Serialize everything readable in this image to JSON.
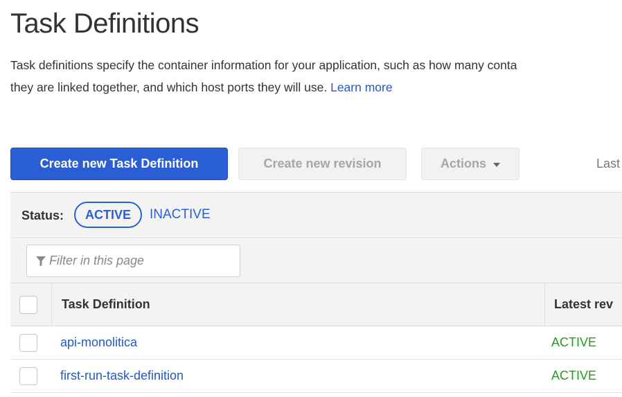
{
  "page": {
    "title": "Task Definitions",
    "description_line1": "Task definitions specify the container information for your application, such as how many conta",
    "description_line2": "they are linked together, and which host ports they will use.",
    "learn_more": "Learn more"
  },
  "toolbar": {
    "create_label": "Create new Task Definition",
    "revision_label": "Create new revision",
    "actions_label": "Actions",
    "last_label": "Last"
  },
  "status_filter": {
    "label": "Status:",
    "active": "ACTIVE",
    "inactive": "INACTIVE"
  },
  "filter": {
    "placeholder": "Filter in this page",
    "icon": "filter-icon"
  },
  "table": {
    "columns": [
      "Task Definition",
      "Latest rev"
    ],
    "rows": [
      {
        "name": "api-monolitica",
        "status": "ACTIVE"
      },
      {
        "name": "first-run-task-definition",
        "status": "ACTIVE"
      }
    ]
  },
  "colors": {
    "primary": "#2a5ed4",
    "link": "#2458c5",
    "active_status": "#1d9e1d"
  }
}
